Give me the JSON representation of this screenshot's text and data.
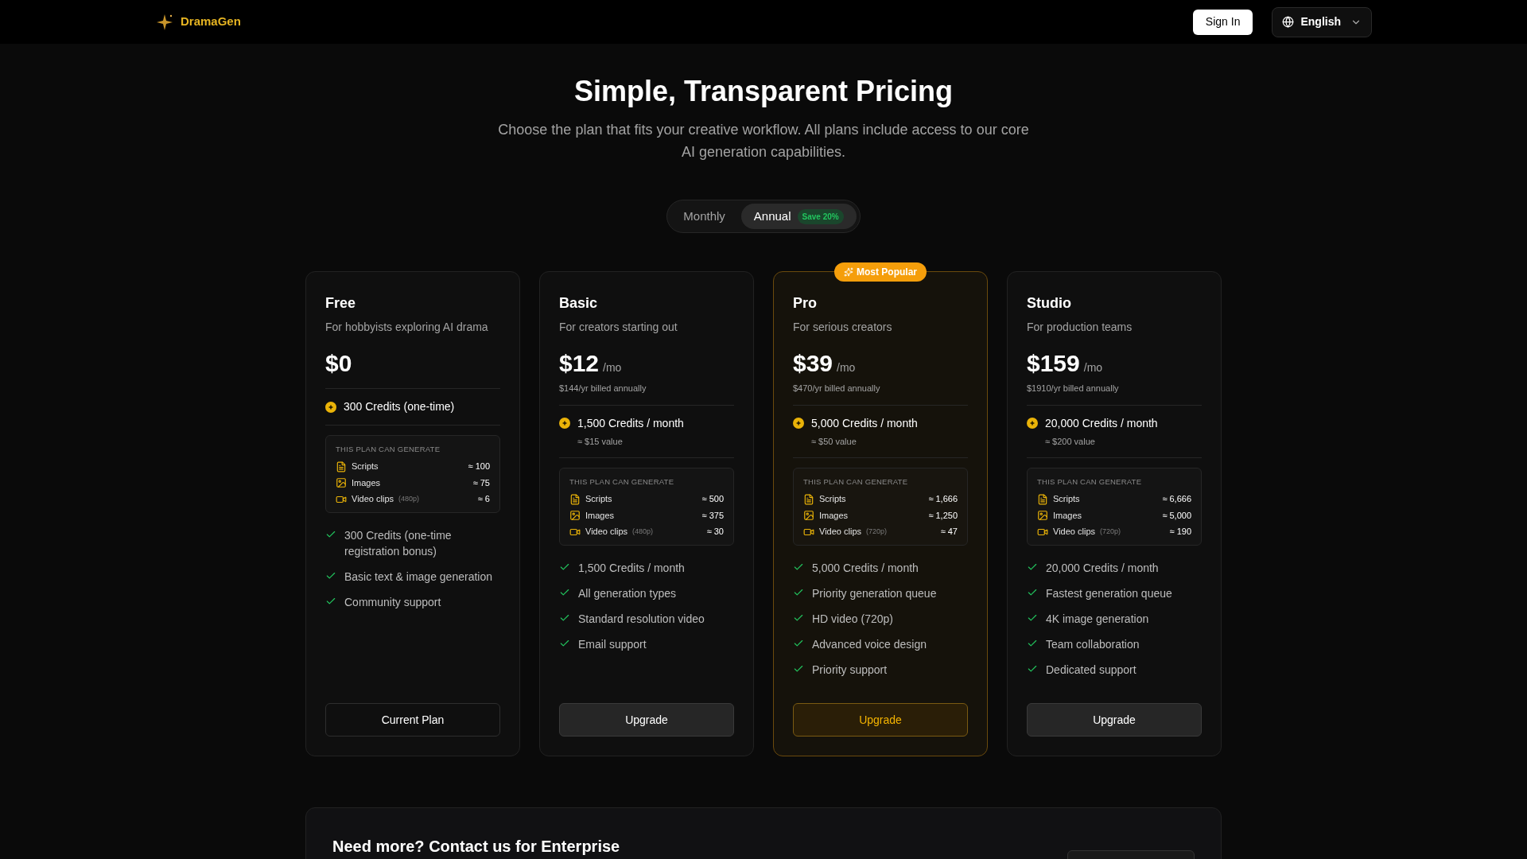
{
  "header": {
    "brand": "DramaGen",
    "sign_in": "Sign In",
    "language": "English"
  },
  "hero": {
    "title": "Simple, Transparent Pricing",
    "subtitle": "Choose the plan that fits your creative workflow. All plans include access to our core AI generation capabilities."
  },
  "billing_toggle": [
    {
      "label": "Monthly",
      "selected": false
    },
    {
      "label": "Annual",
      "selected": true,
      "badge": "Save 20%"
    }
  ],
  "plans": [
    {
      "name": "Free",
      "tagline": "For hobbyists exploring AI drama",
      "price": "$0",
      "featured": false,
      "credits": "300 Credits (one-time)",
      "generate_title": "THIS PLAN CAN GENERATE",
      "generate": [
        {
          "kind": "script",
          "label": "Scripts",
          "amount": "≈ 100"
        },
        {
          "kind": "image",
          "label": "Images",
          "amount": "≈ 75"
        },
        {
          "kind": "video",
          "label": "Video clips",
          "note": "(480p)",
          "amount": "≈ 6"
        }
      ],
      "features": [
        "300 Credits (one-time registration bonus)",
        "Basic text & image generation",
        "Community support"
      ],
      "button": {
        "label": "Current Plan",
        "kind": "current"
      }
    },
    {
      "name": "Basic",
      "tagline": "For creators starting out",
      "price": "$12",
      "period": "/mo",
      "billed": "$144/yr billed annually",
      "featured": false,
      "credits": "1,500 Credits / month",
      "credits_value": "≈ $15 value",
      "generate_title": "THIS PLAN CAN GENERATE",
      "generate": [
        {
          "kind": "script",
          "label": "Scripts",
          "amount": "≈ 500"
        },
        {
          "kind": "image",
          "label": "Images",
          "amount": "≈ 375"
        },
        {
          "kind": "video",
          "label": "Video clips",
          "note": "(480p)",
          "amount": "≈ 30"
        }
      ],
      "features": [
        "1,500 Credits / month",
        "All generation types",
        "Standard resolution video",
        "Email support"
      ],
      "button": {
        "label": "Upgrade",
        "kind": "upgrade"
      }
    },
    {
      "name": "Pro",
      "tagline": "For serious creators",
      "price": "$39",
      "period": "/mo",
      "billed": "$470/yr billed annually",
      "featured": true,
      "badge": "Most Popular",
      "credits": "5,000 Credits / month",
      "credits_value": "≈ $50 value",
      "generate_title": "THIS PLAN CAN GENERATE",
      "generate": [
        {
          "kind": "script",
          "label": "Scripts",
          "amount": "≈ 1,666"
        },
        {
          "kind": "image",
          "label": "Images",
          "amount": "≈ 1,250"
        },
        {
          "kind": "video",
          "label": "Video clips",
          "note": "(720p)",
          "amount": "≈ 47"
        }
      ],
      "features": [
        "5,000 Credits / month",
        "Priority generation queue",
        "HD video (720p)",
        "Advanced voice design",
        "Priority support"
      ],
      "button": {
        "label": "Upgrade",
        "kind": "upgrade"
      }
    },
    {
      "name": "Studio",
      "tagline": "For production teams",
      "price": "$159",
      "period": "/mo",
      "billed": "$1910/yr billed annually",
      "featured": false,
      "credits": "20,000 Credits / month",
      "credits_value": "≈ $200 value",
      "generate_title": "THIS PLAN CAN GENERATE",
      "generate": [
        {
          "kind": "script",
          "label": "Scripts",
          "amount": "≈ 6,666"
        },
        {
          "kind": "image",
          "label": "Images",
          "amount": "≈ 5,000"
        },
        {
          "kind": "video",
          "label": "Video clips",
          "note": "(720p)",
          "amount": "≈ 190"
        }
      ],
      "features": [
        "20,000 Credits / month",
        "Fastest generation queue",
        "4K image generation",
        "Team collaboration",
        "Dedicated support"
      ],
      "button": {
        "label": "Upgrade",
        "kind": "upgrade"
      }
    }
  ],
  "enterprise": {
    "title": "Need more? Contact us for Enterprise"
  }
}
